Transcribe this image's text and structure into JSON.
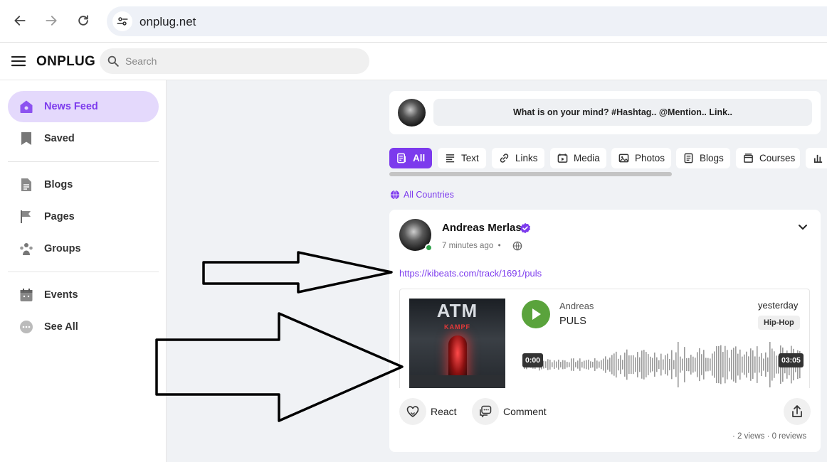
{
  "browser": {
    "url": "onplug.net"
  },
  "header": {
    "brand": "ONPLUG",
    "search_placeholder": "Search"
  },
  "sidebar": {
    "items": [
      {
        "label": "News Feed",
        "icon": "home-icon",
        "active": true
      },
      {
        "label": "Saved",
        "icon": "bookmark-icon"
      },
      {
        "label": "Blogs",
        "icon": "document-icon"
      },
      {
        "label": "Pages",
        "icon": "flag-icon"
      },
      {
        "label": "Groups",
        "icon": "groups-icon"
      },
      {
        "label": "Events",
        "icon": "calendar-icon"
      },
      {
        "label": "See All",
        "icon": "more-icon"
      }
    ]
  },
  "composer": {
    "placeholder": "What is on your mind? #Hashtag.. @Mention.. Link.."
  },
  "filters": [
    {
      "label": "All",
      "icon": "feed-icon",
      "active": true
    },
    {
      "label": "Text",
      "icon": "text-icon"
    },
    {
      "label": "Links",
      "icon": "link-icon"
    },
    {
      "label": "Media",
      "icon": "media-icon"
    },
    {
      "label": "Photos",
      "icon": "photo-icon"
    },
    {
      "label": "Blogs",
      "icon": "blog-icon"
    },
    {
      "label": "Courses",
      "icon": "course-icon"
    }
  ],
  "countries_label": "All Countries",
  "post": {
    "author": "Andreas Merlas",
    "time": "7 minutes ago",
    "time_separator": "•",
    "link": "https://kibeats.com/track/1691/puls",
    "track": {
      "cover_title": "ATM",
      "cover_subtitle": "KAMPF",
      "artist": "Andreas",
      "name": "PULS",
      "date": "yesterday",
      "genre": "Hip-Hop",
      "time_current": "0:00",
      "time_total": "03:05"
    },
    "actions": {
      "react": "React",
      "comment": "Comment"
    },
    "stats": "· 2 views · 0 reviews"
  },
  "colors": {
    "accent": "#7c3aed",
    "play": "#5aa33c",
    "online": "#31a24c"
  }
}
